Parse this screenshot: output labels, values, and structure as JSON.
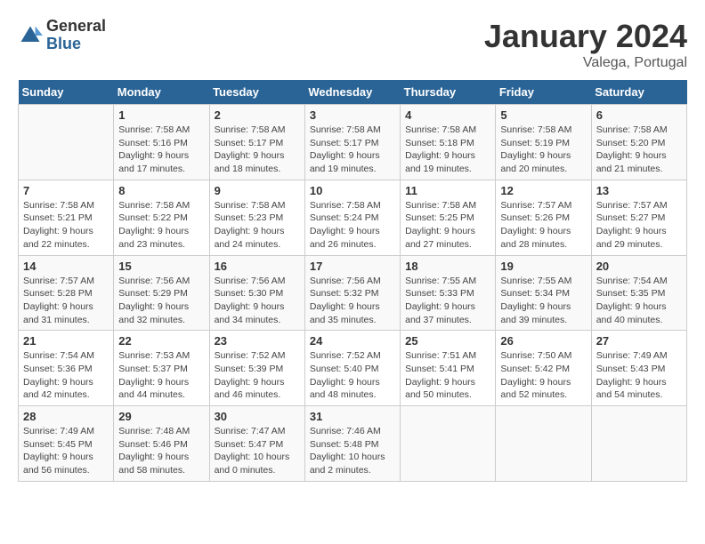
{
  "header": {
    "logo_general": "General",
    "logo_blue": "Blue",
    "month_title": "January 2024",
    "location": "Valega, Portugal"
  },
  "days_of_week": [
    "Sunday",
    "Monday",
    "Tuesday",
    "Wednesday",
    "Thursday",
    "Friday",
    "Saturday"
  ],
  "weeks": [
    [
      {
        "day": "",
        "sunrise": "",
        "sunset": "",
        "daylight": ""
      },
      {
        "day": "1",
        "sunrise": "Sunrise: 7:58 AM",
        "sunset": "Sunset: 5:16 PM",
        "daylight": "Daylight: 9 hours and 17 minutes."
      },
      {
        "day": "2",
        "sunrise": "Sunrise: 7:58 AM",
        "sunset": "Sunset: 5:17 PM",
        "daylight": "Daylight: 9 hours and 18 minutes."
      },
      {
        "day": "3",
        "sunrise": "Sunrise: 7:58 AM",
        "sunset": "Sunset: 5:17 PM",
        "daylight": "Daylight: 9 hours and 19 minutes."
      },
      {
        "day": "4",
        "sunrise": "Sunrise: 7:58 AM",
        "sunset": "Sunset: 5:18 PM",
        "daylight": "Daylight: 9 hours and 19 minutes."
      },
      {
        "day": "5",
        "sunrise": "Sunrise: 7:58 AM",
        "sunset": "Sunset: 5:19 PM",
        "daylight": "Daylight: 9 hours and 20 minutes."
      },
      {
        "day": "6",
        "sunrise": "Sunrise: 7:58 AM",
        "sunset": "Sunset: 5:20 PM",
        "daylight": "Daylight: 9 hours and 21 minutes."
      }
    ],
    [
      {
        "day": "7",
        "sunrise": "Sunrise: 7:58 AM",
        "sunset": "Sunset: 5:21 PM",
        "daylight": "Daylight: 9 hours and 22 minutes."
      },
      {
        "day": "8",
        "sunrise": "Sunrise: 7:58 AM",
        "sunset": "Sunset: 5:22 PM",
        "daylight": "Daylight: 9 hours and 23 minutes."
      },
      {
        "day": "9",
        "sunrise": "Sunrise: 7:58 AM",
        "sunset": "Sunset: 5:23 PM",
        "daylight": "Daylight: 9 hours and 24 minutes."
      },
      {
        "day": "10",
        "sunrise": "Sunrise: 7:58 AM",
        "sunset": "Sunset: 5:24 PM",
        "daylight": "Daylight: 9 hours and 26 minutes."
      },
      {
        "day": "11",
        "sunrise": "Sunrise: 7:58 AM",
        "sunset": "Sunset: 5:25 PM",
        "daylight": "Daylight: 9 hours and 27 minutes."
      },
      {
        "day": "12",
        "sunrise": "Sunrise: 7:57 AM",
        "sunset": "Sunset: 5:26 PM",
        "daylight": "Daylight: 9 hours and 28 minutes."
      },
      {
        "day": "13",
        "sunrise": "Sunrise: 7:57 AM",
        "sunset": "Sunset: 5:27 PM",
        "daylight": "Daylight: 9 hours and 29 minutes."
      }
    ],
    [
      {
        "day": "14",
        "sunrise": "Sunrise: 7:57 AM",
        "sunset": "Sunset: 5:28 PM",
        "daylight": "Daylight: 9 hours and 31 minutes."
      },
      {
        "day": "15",
        "sunrise": "Sunrise: 7:56 AM",
        "sunset": "Sunset: 5:29 PM",
        "daylight": "Daylight: 9 hours and 32 minutes."
      },
      {
        "day": "16",
        "sunrise": "Sunrise: 7:56 AM",
        "sunset": "Sunset: 5:30 PM",
        "daylight": "Daylight: 9 hours and 34 minutes."
      },
      {
        "day": "17",
        "sunrise": "Sunrise: 7:56 AM",
        "sunset": "Sunset: 5:32 PM",
        "daylight": "Daylight: 9 hours and 35 minutes."
      },
      {
        "day": "18",
        "sunrise": "Sunrise: 7:55 AM",
        "sunset": "Sunset: 5:33 PM",
        "daylight": "Daylight: 9 hours and 37 minutes."
      },
      {
        "day": "19",
        "sunrise": "Sunrise: 7:55 AM",
        "sunset": "Sunset: 5:34 PM",
        "daylight": "Daylight: 9 hours and 39 minutes."
      },
      {
        "day": "20",
        "sunrise": "Sunrise: 7:54 AM",
        "sunset": "Sunset: 5:35 PM",
        "daylight": "Daylight: 9 hours and 40 minutes."
      }
    ],
    [
      {
        "day": "21",
        "sunrise": "Sunrise: 7:54 AM",
        "sunset": "Sunset: 5:36 PM",
        "daylight": "Daylight: 9 hours and 42 minutes."
      },
      {
        "day": "22",
        "sunrise": "Sunrise: 7:53 AM",
        "sunset": "Sunset: 5:37 PM",
        "daylight": "Daylight: 9 hours and 44 minutes."
      },
      {
        "day": "23",
        "sunrise": "Sunrise: 7:52 AM",
        "sunset": "Sunset: 5:39 PM",
        "daylight": "Daylight: 9 hours and 46 minutes."
      },
      {
        "day": "24",
        "sunrise": "Sunrise: 7:52 AM",
        "sunset": "Sunset: 5:40 PM",
        "daylight": "Daylight: 9 hours and 48 minutes."
      },
      {
        "day": "25",
        "sunrise": "Sunrise: 7:51 AM",
        "sunset": "Sunset: 5:41 PM",
        "daylight": "Daylight: 9 hours and 50 minutes."
      },
      {
        "day": "26",
        "sunrise": "Sunrise: 7:50 AM",
        "sunset": "Sunset: 5:42 PM",
        "daylight": "Daylight: 9 hours and 52 minutes."
      },
      {
        "day": "27",
        "sunrise": "Sunrise: 7:49 AM",
        "sunset": "Sunset: 5:43 PM",
        "daylight": "Daylight: 9 hours and 54 minutes."
      }
    ],
    [
      {
        "day": "28",
        "sunrise": "Sunrise: 7:49 AM",
        "sunset": "Sunset: 5:45 PM",
        "daylight": "Daylight: 9 hours and 56 minutes."
      },
      {
        "day": "29",
        "sunrise": "Sunrise: 7:48 AM",
        "sunset": "Sunset: 5:46 PM",
        "daylight": "Daylight: 9 hours and 58 minutes."
      },
      {
        "day": "30",
        "sunrise": "Sunrise: 7:47 AM",
        "sunset": "Sunset: 5:47 PM",
        "daylight": "Daylight: 10 hours and 0 minutes."
      },
      {
        "day": "31",
        "sunrise": "Sunrise: 7:46 AM",
        "sunset": "Sunset: 5:48 PM",
        "daylight": "Daylight: 10 hours and 2 minutes."
      },
      {
        "day": "",
        "sunrise": "",
        "sunset": "",
        "daylight": ""
      },
      {
        "day": "",
        "sunrise": "",
        "sunset": "",
        "daylight": ""
      },
      {
        "day": "",
        "sunrise": "",
        "sunset": "",
        "daylight": ""
      }
    ]
  ]
}
